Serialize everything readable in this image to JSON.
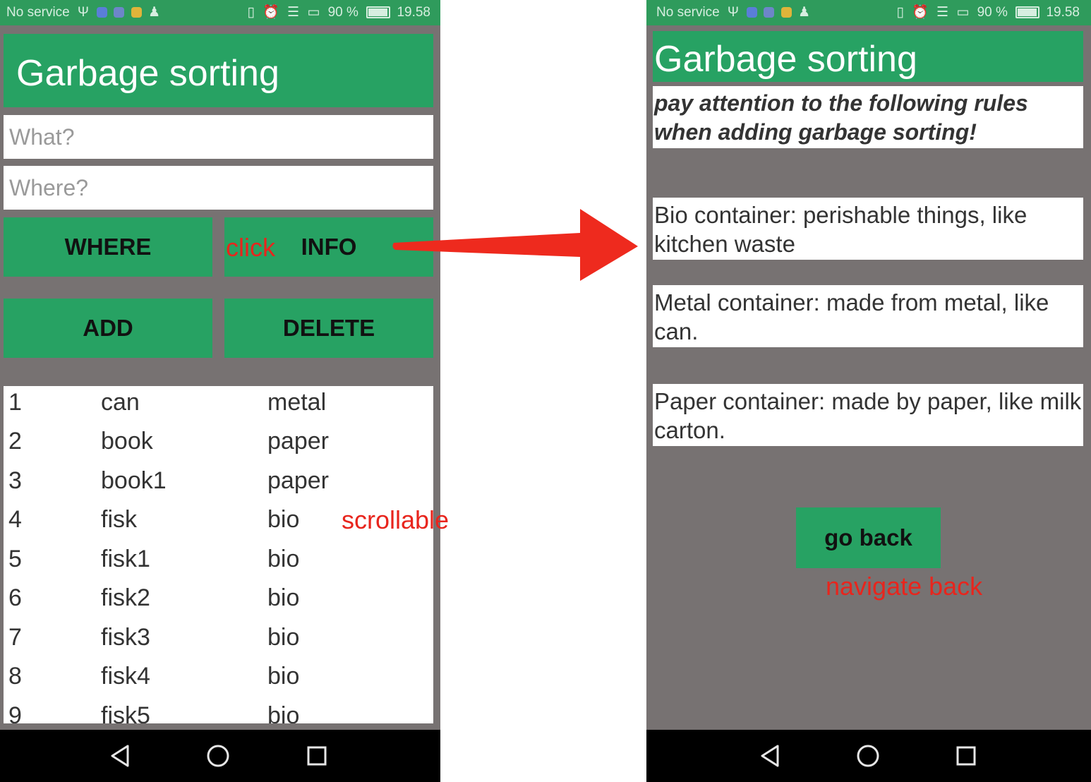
{
  "colors": {
    "green": "#27a263",
    "status_green": "#2f9b5c",
    "background_gray": "#777272",
    "annotation_red": "#e8251d"
  },
  "status_bar": {
    "carrier": "No service",
    "battery": "90 %",
    "battery_level": 0.9,
    "time": "19.58",
    "icons": [
      "usb-icon",
      "app-notification-icon",
      "app-notification-icon",
      "app-notification-icon",
      "person-icon",
      "vibrate-icon",
      "alarm-icon",
      "wifi-icon",
      "sim-icon"
    ]
  },
  "main_screen": {
    "title": "Garbage sorting",
    "what_placeholder": "What?",
    "where_placeholder": "Where?",
    "buttons": {
      "where": "WHERE",
      "info": "INFO",
      "add": "ADD",
      "delete": "DELETE"
    },
    "list": [
      {
        "num": "1",
        "item": "can",
        "bin": "metal"
      },
      {
        "num": "2",
        "item": "book",
        "bin": "paper"
      },
      {
        "num": "3",
        "item": "book1",
        "bin": "paper"
      },
      {
        "num": "4",
        "item": "fisk",
        "bin": "bio"
      },
      {
        "num": "5",
        "item": "fisk1",
        "bin": "bio"
      },
      {
        "num": "6",
        "item": "fisk2",
        "bin": "bio"
      },
      {
        "num": "7",
        "item": "fisk3",
        "bin": "bio"
      },
      {
        "num": "8",
        "item": "fisk4",
        "bin": "bio"
      },
      {
        "num": "9",
        "item": "fisk5",
        "bin": "bio"
      }
    ]
  },
  "info_screen": {
    "title": "Garbage sorting",
    "warning": "pay attention to the following rules when adding garbage sorting!",
    "rules": [
      "Bio container: perishable things, like kitchen waste",
      "Metal container: made from metal, like can.",
      "Paper container: made by paper, like milk carton."
    ],
    "go_back": "go back"
  },
  "annotations": {
    "click": "click",
    "scrollable": "scrollable",
    "navigate_back": "navigate back"
  },
  "nav_bar": {
    "icons": [
      "back-icon",
      "home-icon",
      "recents-icon"
    ]
  }
}
